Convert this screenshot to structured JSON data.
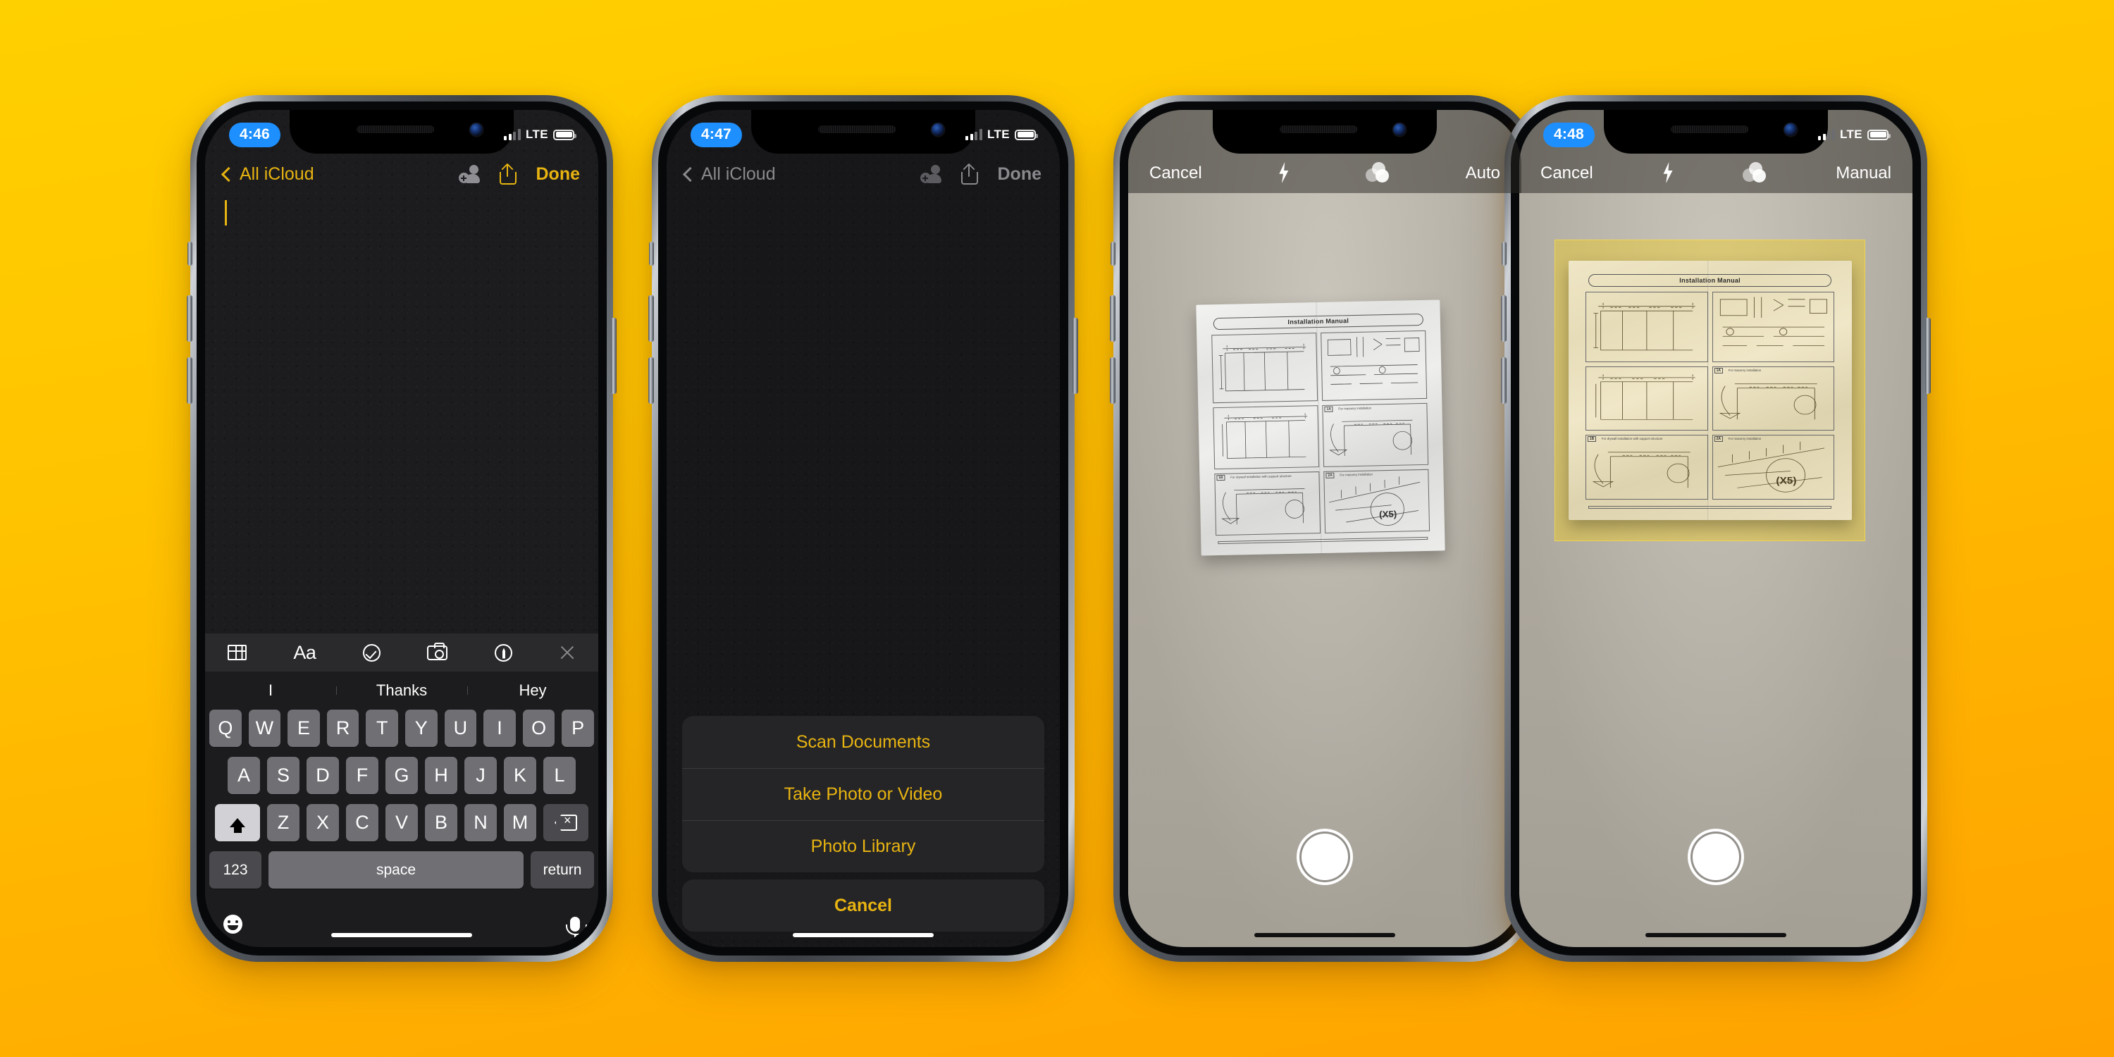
{
  "background": {
    "from": "#FFD000",
    "to": "#FFA200"
  },
  "accent": {
    "yellow": "#E8B411",
    "blue": "#1E8FFF",
    "dim_grey": "#8a8a8e"
  },
  "phones": [
    {
      "id": "phone-notes-editing",
      "status": {
        "time": "4:46",
        "carrier": "LTE",
        "bars_total": 4,
        "bars_active": 2,
        "battery_full": true,
        "visible": true
      },
      "nav": {
        "back_label": "All iCloud",
        "done_label": "Done",
        "dimmed": false,
        "icons": [
          "add-person-icon",
          "share-icon"
        ]
      },
      "note": {
        "text": "",
        "caret_visible": true
      },
      "accessory_bar": {
        "icons": [
          "table-icon",
          "format-aa-icon",
          "checklist-icon",
          "camera-icon",
          "markup-pen-icon",
          "close-icon"
        ],
        "aa_label": "Aa"
      },
      "keyboard": {
        "suggestions": [
          "I",
          "Thanks",
          "Hey"
        ],
        "row1": [
          "Q",
          "W",
          "E",
          "R",
          "T",
          "Y",
          "U",
          "I",
          "O",
          "P"
        ],
        "row2": [
          "A",
          "S",
          "D",
          "F",
          "G",
          "H",
          "J",
          "K",
          "L"
        ],
        "row3": [
          "Z",
          "X",
          "C",
          "V",
          "B",
          "N",
          "M"
        ],
        "shift_label": "shift-key",
        "delete_label": "delete-key",
        "numbers_label": "123",
        "space_label": "space",
        "return_label": "return",
        "emoji_label": "emoji-key",
        "dictation_label": "dictation-key"
      }
    },
    {
      "id": "phone-notes-actionsheet",
      "status": {
        "time": "4:47",
        "carrier": "LTE",
        "bars_total": 4,
        "bars_active": 2,
        "battery_full": true,
        "visible": true
      },
      "nav": {
        "back_label": "All iCloud",
        "done_label": "Done",
        "dimmed": true,
        "icons": [
          "add-person-icon",
          "share-icon"
        ]
      },
      "action_sheet": {
        "options": [
          "Scan Documents",
          "Take Photo or Video",
          "Photo Library"
        ],
        "cancel_label": "Cancel"
      }
    },
    {
      "id": "phone-scanner-auto",
      "status": {
        "time": "",
        "carrier": "",
        "visible": false
      },
      "camera_bar": {
        "cancel_label": "Cancel",
        "flash_label": "flash-icon",
        "filters_label": "color-filters-icon",
        "mode_label": "Auto"
      },
      "document": {
        "title": "Installation Manual",
        "panels": [
          {
            "label": "",
            "caption": ""
          },
          {
            "label": "",
            "caption": ""
          },
          {
            "label": "",
            "caption": ""
          },
          {
            "label": "1A",
            "caption": "For masonry installation"
          },
          {
            "label": "1B",
            "caption": "For drywall installation with support structure"
          },
          {
            "label": "2A",
            "caption": "For masonry installation"
          }
        ],
        "annotations": [
          "2000mm 78 3/4\"",
          "450 mm",
          "17.72\"",
          "H+43MM  H+1 3/4\"",
          "4/10\" 10mm",
          "(X5)"
        ],
        "scan_overlay": false
      },
      "shutter_label": "shutter-button"
    },
    {
      "id": "phone-scanner-manual",
      "status": {
        "time": "4:48",
        "carrier": "LTE",
        "bars_total": 4,
        "bars_active": 2,
        "battery_full": true,
        "visible": true
      },
      "camera_bar": {
        "cancel_label": "Cancel",
        "flash_label": "flash-icon",
        "filters_label": "color-filters-icon",
        "mode_label": "Manual"
      },
      "document": {
        "title": "Installation Manual",
        "panels": [
          {
            "label": "",
            "caption": ""
          },
          {
            "label": "",
            "caption": ""
          },
          {
            "label": "",
            "caption": ""
          },
          {
            "label": "1A",
            "caption": "For masonry installation"
          },
          {
            "label": "1B",
            "caption": "For drywall installation with support structure"
          },
          {
            "label": "2A",
            "caption": "For masonry installation"
          }
        ],
        "annotations": [
          "2000mm 78 3/4\"",
          "450 mm",
          "17.72\"",
          "H+43MM  H+1 3/4\"",
          "4/10\" 10mm",
          "(X5)"
        ],
        "scan_overlay": true,
        "scan_overlay_color": "#F0CD28"
      },
      "shutter_label": "shutter-button"
    }
  ]
}
